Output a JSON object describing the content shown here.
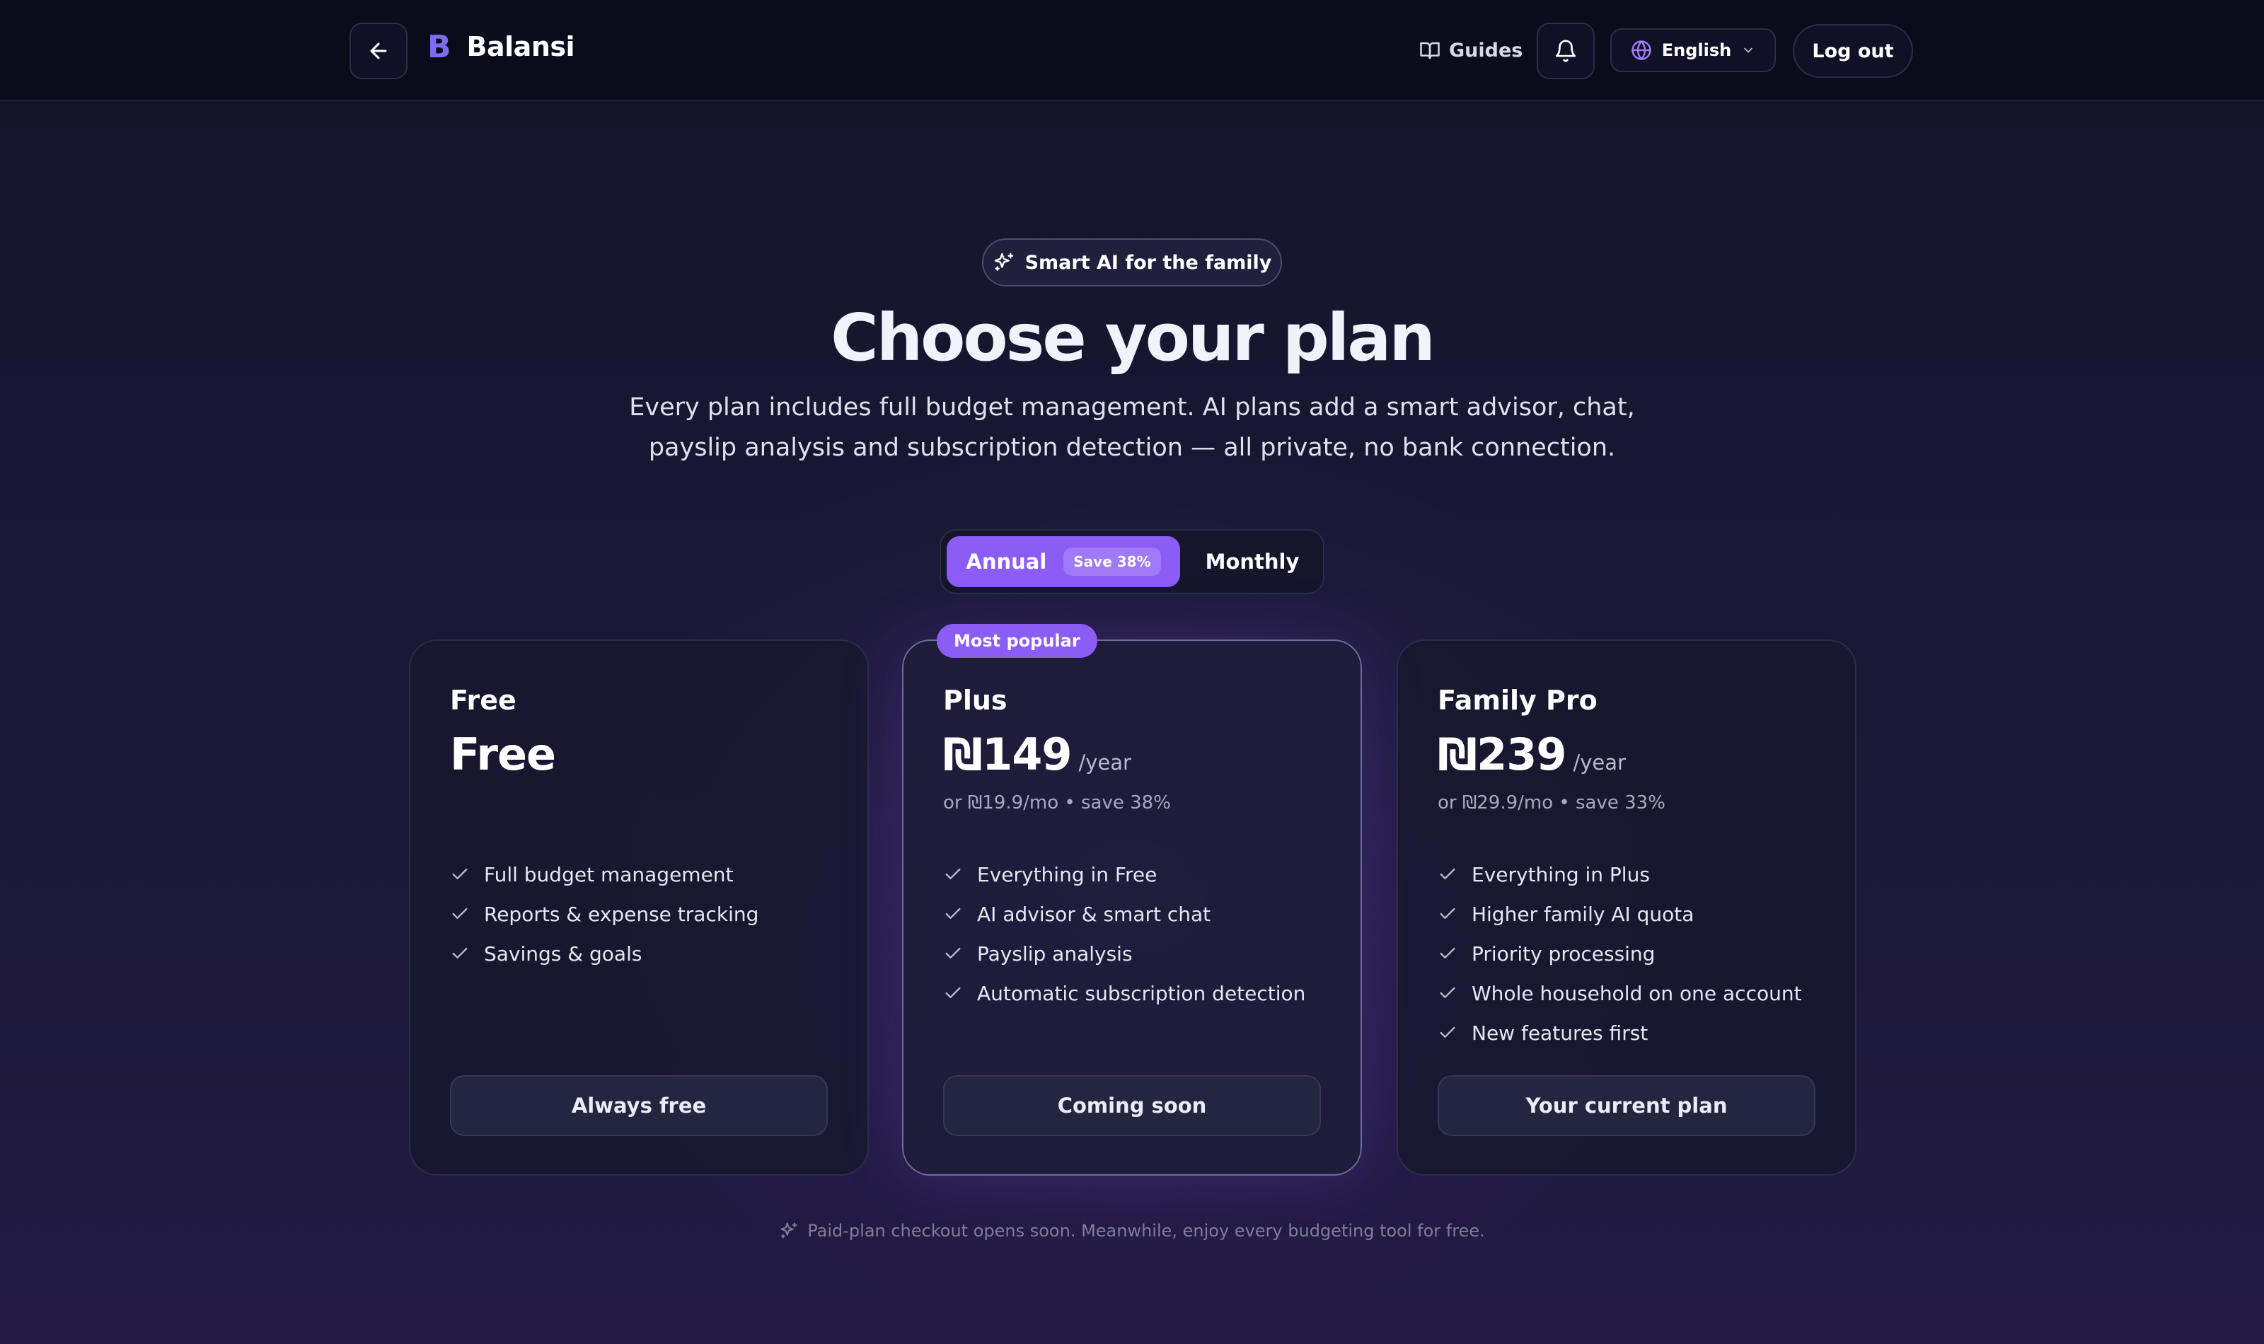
{
  "header": {
    "brand": {
      "mark": "B",
      "name": "Balansi"
    },
    "guides_label": "Guides",
    "language_label": "English",
    "logout_label": "Log out"
  },
  "hero": {
    "badge": "Smart AI for the family",
    "title": "Choose your plan",
    "subtitle_line1": "Every plan includes full budget management. AI plans add a smart advisor, chat,",
    "subtitle_line2": "payslip analysis and subscription detection — all private, no bank connection."
  },
  "billing_toggle": {
    "annual_label": "Annual",
    "annual_badge": "Save 38%",
    "monthly_label": "Monthly",
    "selected": "Annual"
  },
  "most_popular_label": "Most popular",
  "plans": [
    {
      "name": "Free",
      "price": "Free",
      "period": "",
      "note": "",
      "features": [
        "Full budget management",
        "Reports & expense tracking",
        "Savings & goals"
      ],
      "button": "Always free"
    },
    {
      "name": "Plus",
      "price": "₪149",
      "period": "/year",
      "note": "or ₪19.9/mo • save 38%",
      "features": [
        "Everything in Free",
        "AI advisor & smart chat",
        "Payslip analysis",
        "Automatic subscription detection"
      ],
      "button": "Coming soon"
    },
    {
      "name": "Family Pro",
      "price": "₪239",
      "period": "/year",
      "note": "or ₪29.9/mo • save 33%",
      "features": [
        "Everything in Plus",
        "Higher family AI quota",
        "Priority processing",
        "Whole household on one account",
        "New features first"
      ],
      "button": "Your current plan"
    }
  ],
  "footnote": "Paid-plan checkout opens soon. Meanwhile, enjoy every budgeting tool for free.",
  "colors": {
    "accent": "#8b5cf6",
    "header_bg": "#0b0c1b",
    "page_bg": "#1a1836"
  }
}
